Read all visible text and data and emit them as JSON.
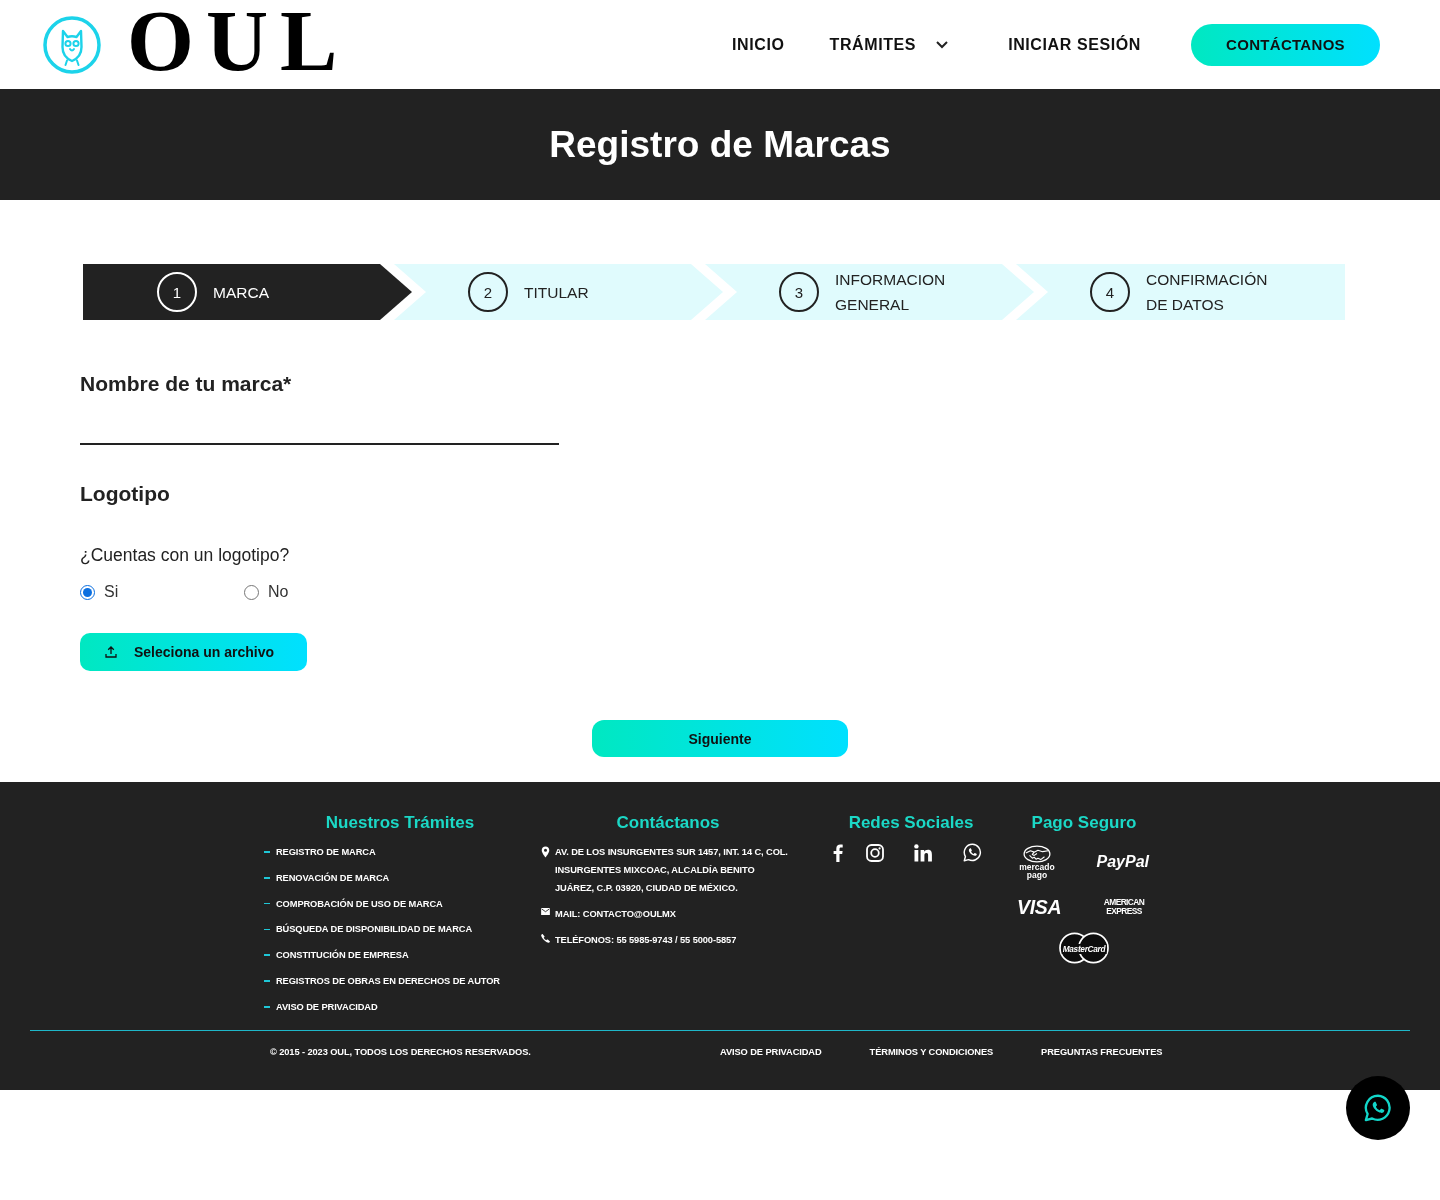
{
  "header": {
    "logo_text": "OUL",
    "nav": [
      {
        "label": "INICIO",
        "kind": "link"
      },
      {
        "label": "TRÁMITES",
        "kind": "dropdown"
      },
      {
        "label": "INICIAR SESIÓN",
        "kind": "link"
      }
    ],
    "cta": "CONTÁCTANOS"
  },
  "hero": {
    "title": "Registro de Marcas"
  },
  "steps": [
    {
      "number": "1",
      "label": "MARCA",
      "selected": true
    },
    {
      "number": "2",
      "label": "TITULAR",
      "selected": false
    },
    {
      "number": "3",
      "label": "INFORMACION GENERAL",
      "selected": false
    },
    {
      "number": "4",
      "label": "CONFIRMACIÓN DE DATOS",
      "selected": false
    }
  ],
  "form": {
    "brand_name": {
      "label": "Nombre de tu marca*"
    },
    "logo": {
      "title": "Logotipo",
      "question": "¿Cuentas con un logotipo?",
      "options": [
        {
          "label": "Si",
          "selected": true
        },
        {
          "label": "No",
          "selected": false
        }
      ],
      "upload_button": "Seleciona un archivo"
    },
    "next_button": "Siguiente"
  },
  "footer": {
    "columns": [
      {
        "kind": "links",
        "title": "Nuestros Trámites",
        "items": [
          "REGISTRO DE MARCA",
          "RENOVACIÓN DE MARCA",
          "COMPROBACIÓN DE USO DE MARCA",
          "BÚSQUEDA DE DISPONIBILIDAD DE MARCA",
          "CONSTITUCIÓN DE EMPRESA",
          "REGISTROS DE OBRAS EN DERECHOS DE AUTOR",
          "AVISO DE PRIVACIDAD"
        ]
      },
      {
        "kind": "contact",
        "title": "Contáctanos",
        "items": [
          {
            "kind": "address",
            "text": "AV. DE LOS INSURGENTES SUR 1457, INT. 14 C, COL. INSURGENTES MIXCOAC, ALCALDÍA BENITO JUÁREZ, C.P. 03920, CIUDAD DE MÉXICO."
          },
          {
            "kind": "mail",
            "text": "MAIL: CONTACTO@OULMX"
          },
          {
            "kind": "phone",
            "text": "TELÉFONOS: 55 5985-9743 / 55 5000-5857"
          }
        ]
      },
      {
        "kind": "social",
        "title": "Redes Sociales"
      },
      {
        "kind": "payments",
        "title": "Pago Seguro",
        "items": [
          {
            "kind": "mercadopago",
            "text": "mercado pago"
          },
          {
            "kind": "paypal",
            "text": "PayPal"
          },
          {
            "kind": "visa",
            "text": "VISA"
          },
          {
            "kind": "amex",
            "text": "AMERICAN EXPRESS"
          },
          {
            "kind": "mastercard",
            "text": "MasterCard"
          }
        ]
      }
    ],
    "copyright": "© 2015 - 2023 OUL, TODOS LOS DERECHOS RESERVADOS.",
    "links": [
      "AVISO DE PRIVACIDAD",
      "TÉRMINOS Y CONDICIONES",
      "PREGUNTAS FRECUENTES"
    ]
  }
}
